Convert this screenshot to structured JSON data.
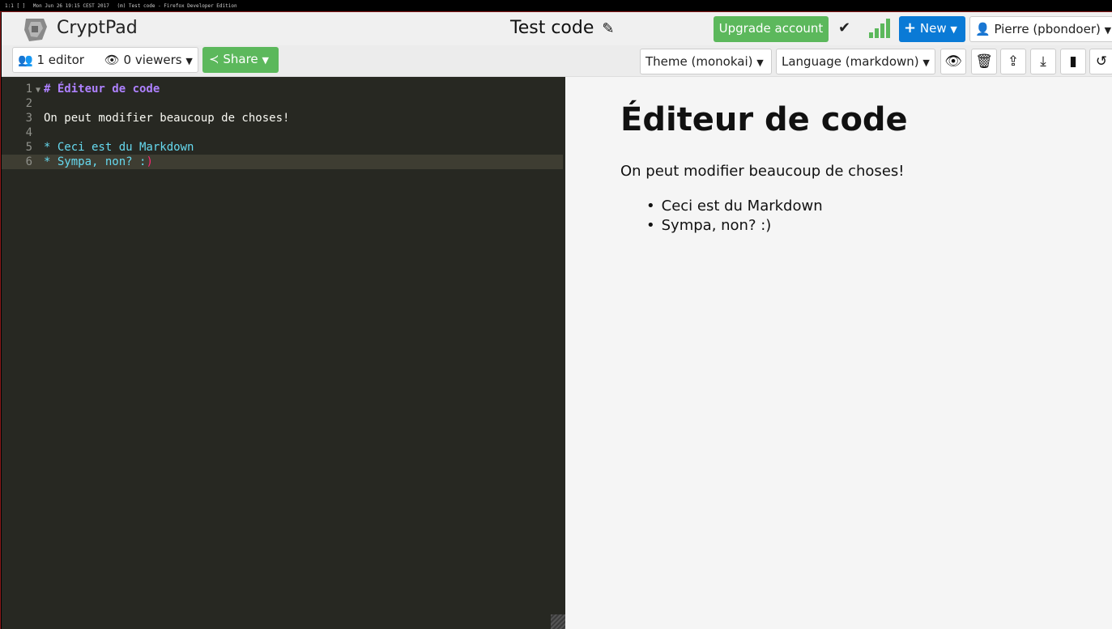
{
  "statusbar": {
    "workspace": "1:1 [ ]",
    "datetime": "Mon Jun 26 19:15 CEST 2017",
    "window_title": "(m) Test code - Firefox Developer Edition"
  },
  "header": {
    "app_name": "CryptPad",
    "doc_title": "Test code",
    "edit_icon": "✎",
    "upgrade_label": "Upgrade account",
    "saved_icon": "✔",
    "new_label": "New",
    "user_label": "Pierre (pbondoer)"
  },
  "toolbar": {
    "editors_label": "1 editor",
    "viewers_label": "0 viewers",
    "share_label": "Share",
    "theme_label": "Theme (monokai)",
    "language_label": "Language (markdown)",
    "icons": [
      "preview-icon",
      "trash-icon",
      "upload-icon",
      "download-icon",
      "bookmark-icon",
      "history-icon"
    ]
  },
  "editor": {
    "lines": [
      {
        "num": "1",
        "text": "# Éditeur de code"
      },
      {
        "num": "2",
        "text": ""
      },
      {
        "num": "3",
        "text": "On peut modifier beaucoup de choses!"
      },
      {
        "num": "4",
        "text": ""
      },
      {
        "num": "5",
        "text": "* Ceci est du Markdown"
      },
      {
        "num": "6",
        "text": "* Sympa, non? :",
        "paren": ")"
      }
    ]
  },
  "preview": {
    "heading": "Éditeur de code",
    "paragraph": "On peut modifier beaucoup de choses!",
    "items": [
      "Ceci est du Markdown",
      "Sympa, non? :)"
    ]
  },
  "colors": {
    "green": "#5cb85c",
    "blue": "#0a7ad6",
    "editor_bg": "#272822"
  }
}
